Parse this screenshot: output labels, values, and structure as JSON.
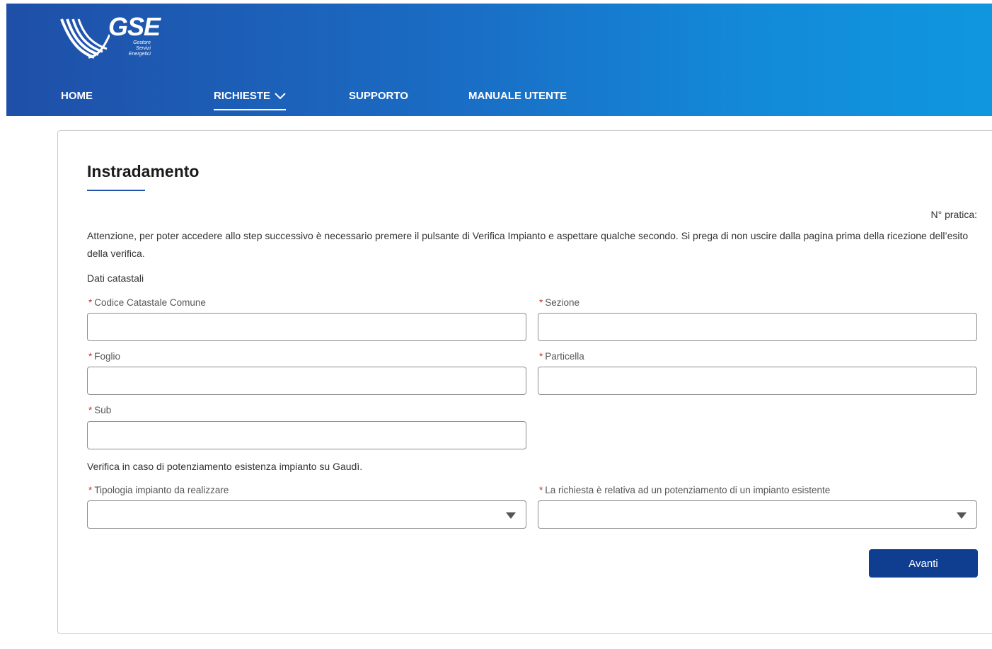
{
  "header": {
    "logo_text": "GSE",
    "logo_sub_lines": [
      "Gestore",
      "Servizi",
      "Energetici"
    ],
    "nav": [
      {
        "label": "HOME"
      },
      {
        "label": "RICHIESTE"
      },
      {
        "label": "SUPPORTO"
      },
      {
        "label": "MANUALE UTENTE"
      }
    ]
  },
  "form": {
    "title": "Instradamento",
    "pratica_label": "N° pratica:",
    "notice": "Attenzione, per poter accedere allo step successivo è necessario premere il pulsante di Verifica Impianto e aspettare qualche secondo. Si prega di non uscire dalla pagina prima della ricezione dell’esito della verifica.",
    "section_catastali": "Dati catastali",
    "required_mark": "*",
    "fields": {
      "codice_catastale": {
        "label": "Codice Catastale Comune",
        "value": ""
      },
      "sezione": {
        "label": "Sezione",
        "value": ""
      },
      "foglio": {
        "label": "Foglio",
        "value": ""
      },
      "particella": {
        "label": "Particella",
        "value": ""
      },
      "sub": {
        "label": "Sub",
        "value": ""
      }
    },
    "section_verifica": "Verifica in caso di potenziamento esistenza impianto su Gaudì.",
    "selects": {
      "tipologia": {
        "label": "Tipologia impianto da realizzare",
        "value": ""
      },
      "potenziamento": {
        "label": "La richiesta è relativa ad un potenziamento di un impianto esistente",
        "value": ""
      }
    },
    "next_button": "Avanti"
  },
  "colors": {
    "primary_button": "#0f3d8f",
    "header_gradient_start": "#1f4fa8",
    "header_gradient_end": "#0f97de",
    "required": "#c23934"
  }
}
